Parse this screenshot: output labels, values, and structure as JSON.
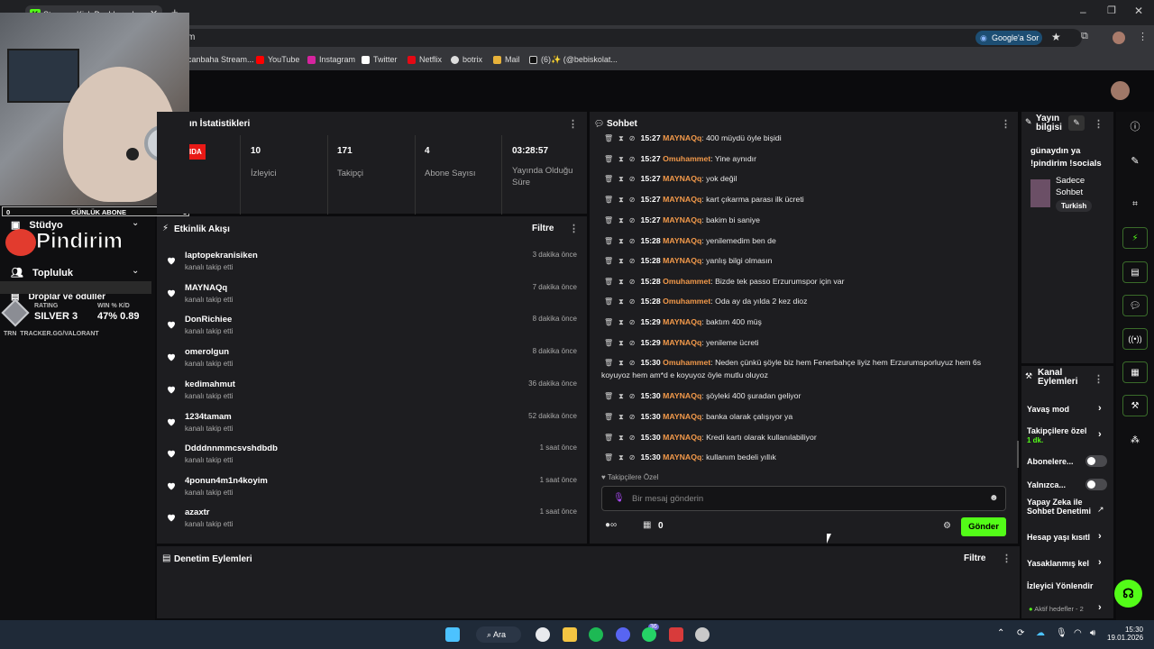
{
  "browser": {
    "tab_title": "Stream - Kick Dashboard",
    "address_fragment": "m",
    "google_button": "Google'a Sor",
    "bookmarks": [
      "canbaha Stream...",
      "YouTube",
      "Instagram",
      "Twitter",
      "Netflix",
      "botrix",
      "Mail",
      "(6)✨ (@bebiskolat..."
    ]
  },
  "overlay": {
    "subs_left": "0",
    "subs_label": "GÜNLÜK ABONE",
    "subs_right": "3",
    "logo_text": "Pindirim",
    "rating_label": "RATING",
    "rating_value": "SILVER 3",
    "winkd_label": "WIN % K/D",
    "winkd_value": "47% 0.89",
    "tracker": "TRACKER.GG/VALORANT",
    "trn": "TRN"
  },
  "sidebar": {
    "studio": "Stüdyo",
    "community": "Topluluk",
    "drops": "Droplar ve ödüller",
    "channel_fragment": "anal"
  },
  "stats": {
    "title_fragment": "ın İstatistikleri",
    "live_fragment": "IDA",
    "items": [
      {
        "value": "10",
        "label": "İzleyici"
      },
      {
        "value": "171",
        "label": "Takipçi"
      },
      {
        "value": "4",
        "label": "Abone Sayısı"
      },
      {
        "value": "03:28:57",
        "label": "Yayında Olduğu Süre"
      }
    ]
  },
  "activity": {
    "title": "Etkinlik Akışı",
    "filter": "Filtre",
    "events": [
      {
        "name": "laptopekranisiken",
        "sub": "kanalı takip etti",
        "time": "3 dakika önce"
      },
      {
        "name": "MAYNAQq",
        "sub": "kanalı takip etti",
        "time": "7 dakika önce"
      },
      {
        "name": "DonRichiee",
        "sub": "kanalı takip etti",
        "time": "8 dakika önce"
      },
      {
        "name": "omerolgun",
        "sub": "kanalı takip etti",
        "time": "8 dakika önce"
      },
      {
        "name": "kedimahmut",
        "sub": "kanalı takip etti",
        "time": "36 dakika önce"
      },
      {
        "name": "1234tamam",
        "sub": "kanalı takip etti",
        "time": "52 dakika önce"
      },
      {
        "name": "Ddddnnmmcsvshdbdb",
        "sub": "kanalı takip etti",
        "time": "1 saat önce"
      },
      {
        "name": "4ponun4m1n4koyim",
        "sub": "kanalı takip etti",
        "time": "1 saat önce"
      },
      {
        "name": "azaxtr",
        "sub": "kanalı takip etti",
        "time": "1 saat önce"
      }
    ]
  },
  "moderation": {
    "title": "Denetim Eylemleri",
    "filter": "Filtre"
  },
  "chat": {
    "title": "Sohbet",
    "messages": [
      {
        "time": "15:27",
        "user": "MAYNAQq",
        "text": ": 400 müydü öyle bişidi"
      },
      {
        "time": "15:27",
        "user": "Omuhammet",
        "text": ": Yine aynıdır"
      },
      {
        "time": "15:27",
        "user": "MAYNAQq",
        "text": ": yok değil"
      },
      {
        "time": "15:27",
        "user": "MAYNAQq",
        "text": ": kart çıkarma parası ilk ücreti"
      },
      {
        "time": "15:27",
        "user": "MAYNAQq",
        "text": ": bakim bi saniye"
      },
      {
        "time": "15:28",
        "user": "MAYNAQq",
        "text": ": yenilemedim ben de"
      },
      {
        "time": "15:28",
        "user": "MAYNAQq",
        "text": ": yanlış bilgi olmasın"
      },
      {
        "time": "15:28",
        "user": "Omuhammet",
        "text": ": Bizde tek passo Erzurumspor için var"
      },
      {
        "time": "15:28",
        "user": "Omuhammet",
        "text": ": Oda ay da yılda 2 kez dioz"
      },
      {
        "time": "15:29",
        "user": "MAYNAQq",
        "text": ": baktım 400 müş"
      },
      {
        "time": "15:29",
        "user": "MAYNAQq",
        "text": ": yenileme ücreti"
      },
      {
        "time": "15:30",
        "user": "Omuhammet",
        "text": ": Neden çünkü şöyle biz hem Fenerbahçe liyiz hem Erzurumsporluyuz hem 6s",
        "cont": "koyuyoz hem am*d e koyuyoz öyle mutlu oluyoz"
      },
      {
        "time": "15:30",
        "user": "MAYNAQq",
        "text": ": şöyleki 400 şuradan geliyor"
      },
      {
        "time": "15:30",
        "user": "MAYNAQq",
        "text": ": banka olarak çalışıyor ya"
      },
      {
        "time": "15:30",
        "user": "MAYNAQq",
        "text": ": Kredi kartı olarak kullanılabiliyor"
      },
      {
        "time": "15:30",
        "user": "MAYNAQq",
        "text": ": kullanım bedeli yıllık"
      }
    ],
    "mode_label": "Takipçilere Özel",
    "input_placeholder": "Bir mesaj gönderin",
    "points": "0",
    "send": "Gönder"
  },
  "stream_info": {
    "title": "Yayın bilgisi",
    "stream_title": "günaydın ya !pindirim !socials",
    "category": "Sadece Sohbet",
    "tag": "Turkish"
  },
  "channel_actions": {
    "title": "Kanal Eylemleri",
    "slow_mode": "Yavaş mod",
    "followers_only": "Takipçilere özel",
    "followers_only_sub": "1 dk.",
    "subs_only": "Abonelere...",
    "emote_only": "Yalnızca...",
    "ai_mod": "Yapay Zeka ile Sohbet Denetimi",
    "age_limit": "Hesap yaşı kısıtl",
    "banned": "Yasaklanmış kel",
    "redirect": "İzleyici Yönlendir",
    "goals": "Aktif hedefler - 2"
  },
  "taskbar": {
    "search": "Ara",
    "badge": "36",
    "time": "15:30",
    "date": "19.01.2026"
  },
  "colors": {
    "kick_green": "#53fc18",
    "accent_orange": "#f2994a",
    "panel": "#1d1d20",
    "live_red": "#e91916"
  }
}
